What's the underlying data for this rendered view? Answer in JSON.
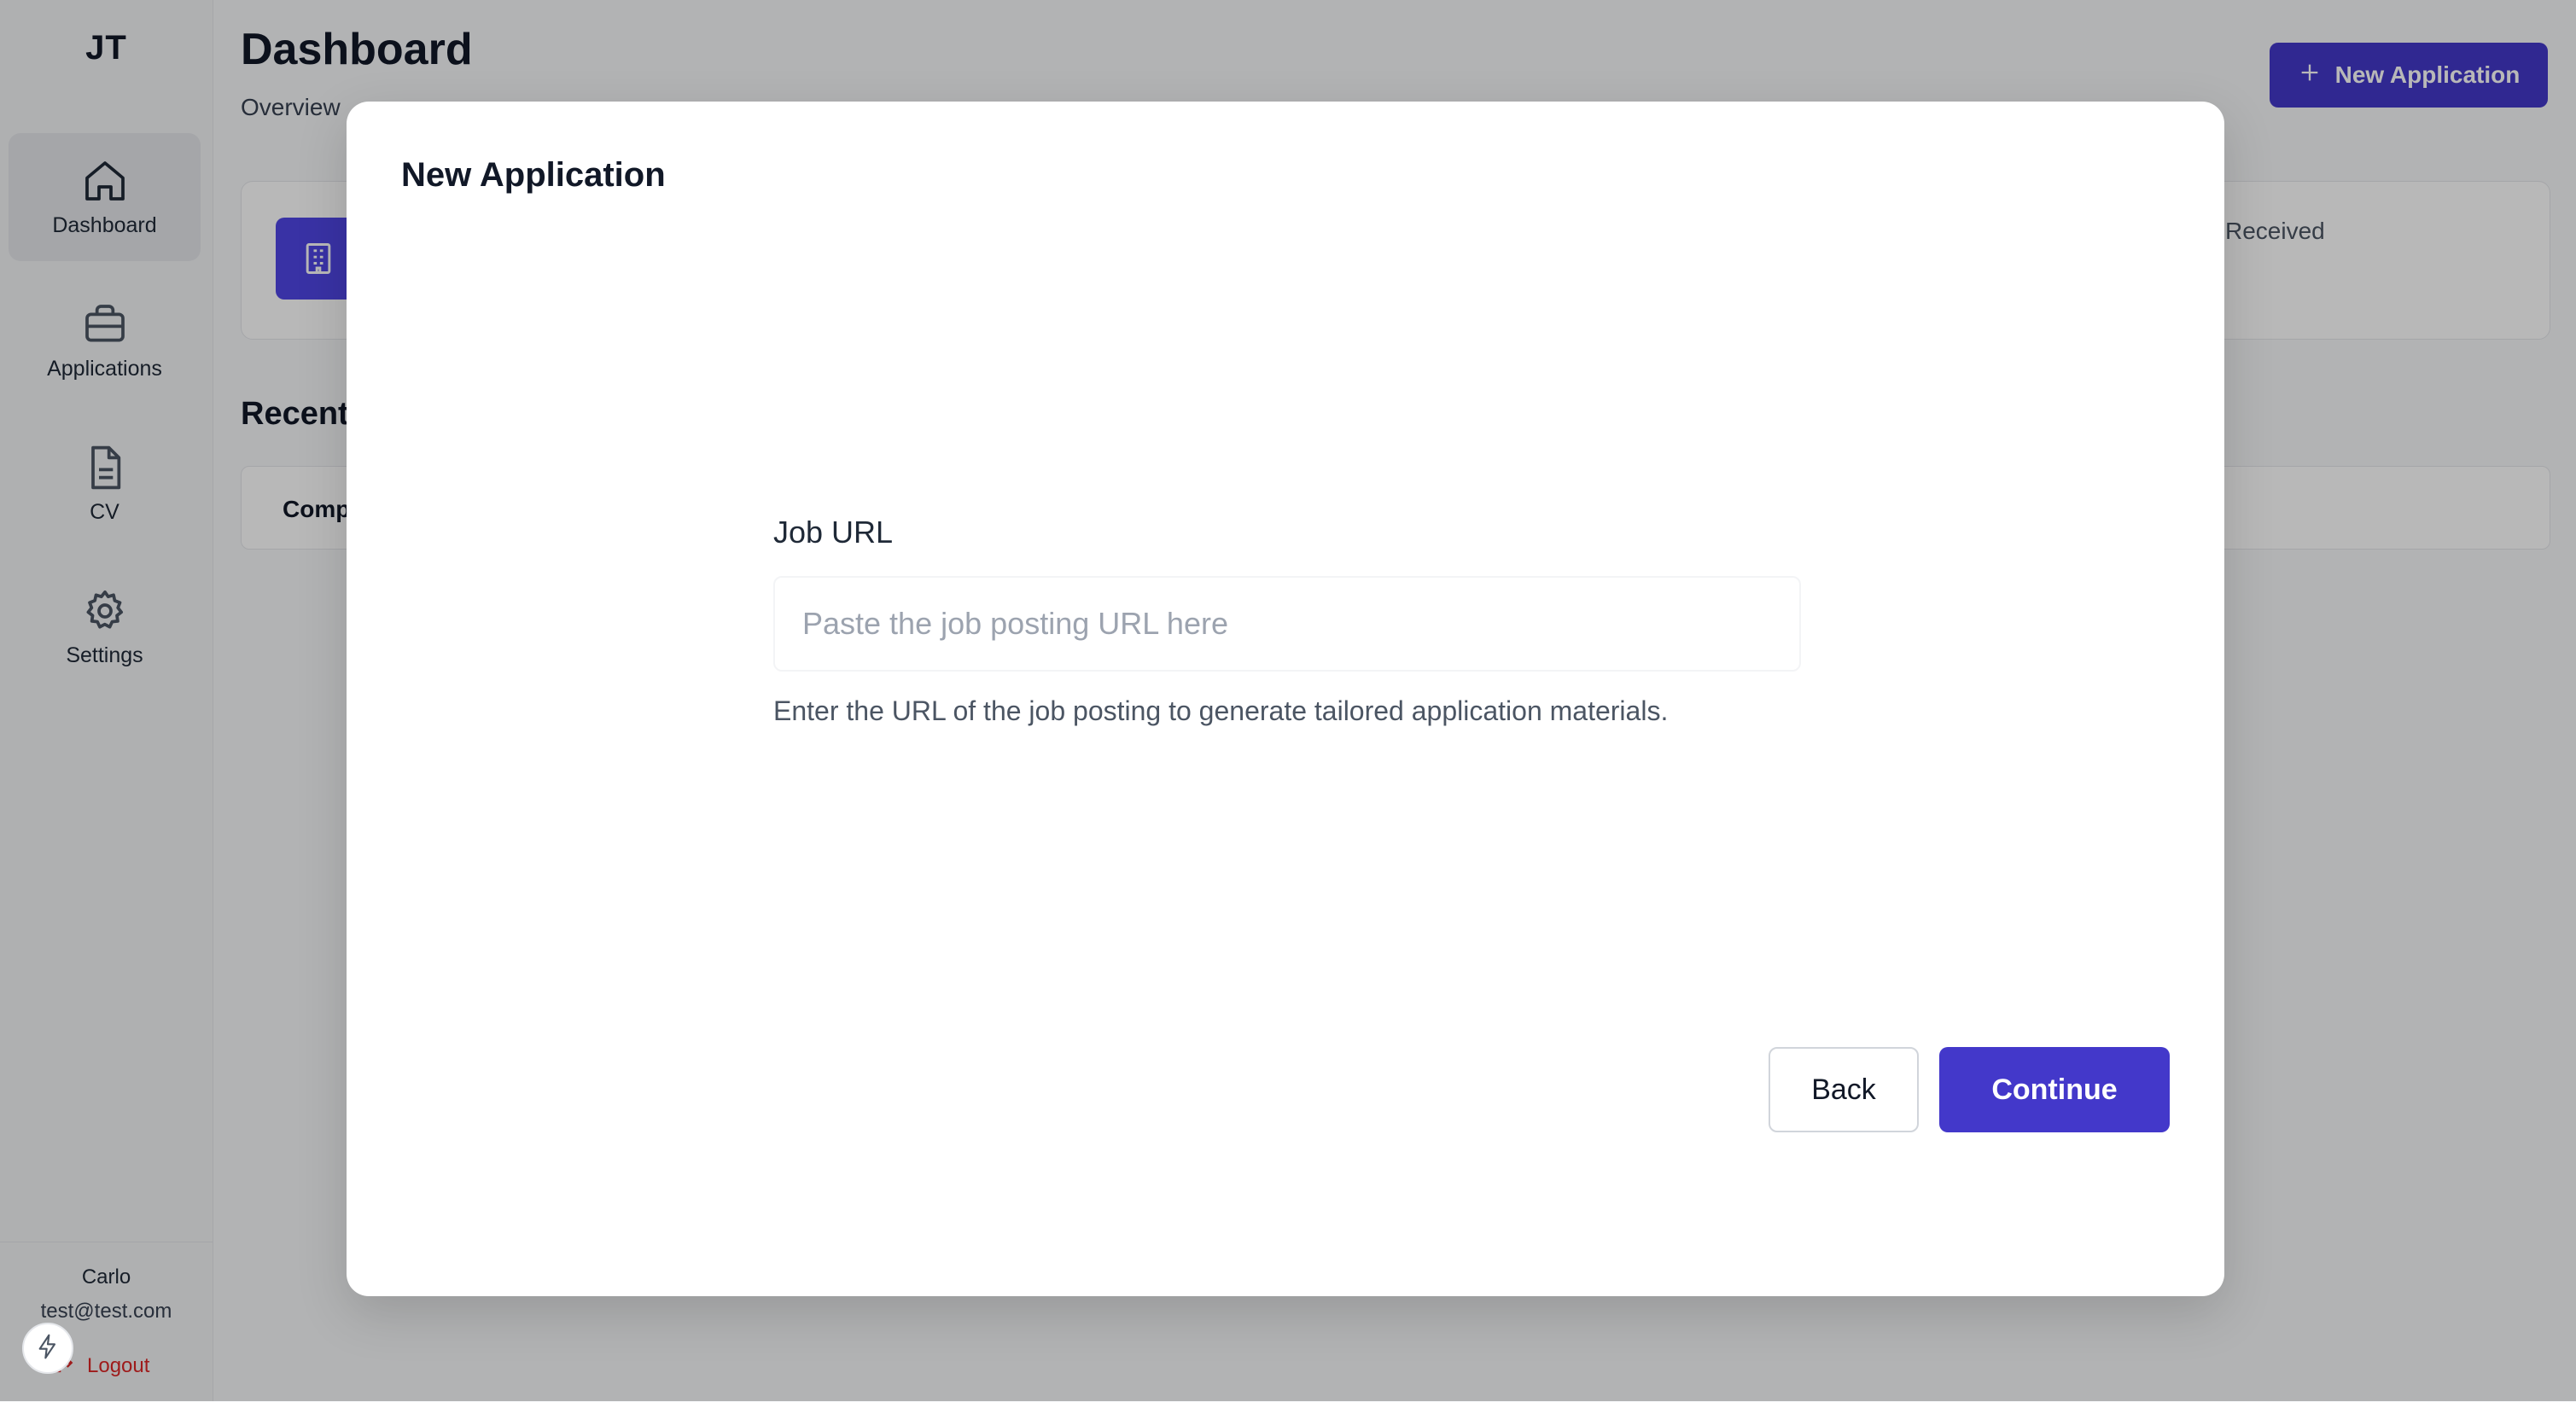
{
  "sidebar": {
    "brand": "JT",
    "items": [
      {
        "label": "Dashboard",
        "icon": "home-icon",
        "active": true
      },
      {
        "label": "Applications",
        "icon": "briefcase-icon",
        "active": false
      },
      {
        "label": "CV",
        "icon": "file-icon",
        "active": false
      },
      {
        "label": "Settings",
        "icon": "gear-icon",
        "active": false
      }
    ],
    "user": {
      "name": "Carlo",
      "email": "test@test.com",
      "logout_label": "Logout"
    }
  },
  "header": {
    "title": "Dashboard",
    "subtitle": "Overview",
    "new_application_label": "New Application"
  },
  "stats": {
    "right_label": "Received"
  },
  "recent": {
    "title": "Recent",
    "column_company": "Comp"
  },
  "modal": {
    "title": "New Application",
    "field_label": "Job URL",
    "input_value": "",
    "input_placeholder": "Paste the job posting URL here",
    "helper_text": "Enter the URL of the job posting to generate tailored application materials.",
    "back_label": "Back",
    "continue_label": "Continue"
  },
  "colors": {
    "accent": "#4338ca",
    "danger": "#dc2626",
    "overlay": "rgba(0,0,0,0.28)"
  }
}
